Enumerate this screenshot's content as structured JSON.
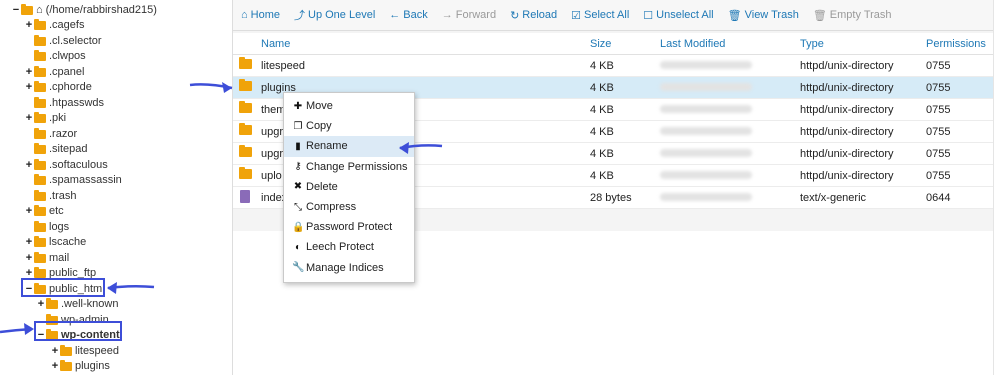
{
  "tree": {
    "root": "(/home/rabbirshad215)",
    "nodes": [
      {
        "toggle": "+",
        "label": ".cagefs",
        "indent": 1
      },
      {
        "toggle": "",
        "label": ".cl.selector",
        "indent": 1
      },
      {
        "toggle": "",
        "label": ".clwpos",
        "indent": 1
      },
      {
        "toggle": "+",
        "label": ".cpanel",
        "indent": 1
      },
      {
        "toggle": "+",
        "label": ".cphorde",
        "indent": 1
      },
      {
        "toggle": "",
        "label": ".htpasswds",
        "indent": 1
      },
      {
        "toggle": "+",
        "label": ".pki",
        "indent": 1
      },
      {
        "toggle": "",
        "label": ".razor",
        "indent": 1
      },
      {
        "toggle": "",
        "label": ".sitepad",
        "indent": 1
      },
      {
        "toggle": "+",
        "label": ".softaculous",
        "indent": 1
      },
      {
        "toggle": "",
        "label": ".spamassassin",
        "indent": 1
      },
      {
        "toggle": "",
        "label": ".trash",
        "indent": 1
      },
      {
        "toggle": "+",
        "label": "etc",
        "indent": 1
      },
      {
        "toggle": "",
        "label": "logs",
        "indent": 1
      },
      {
        "toggle": "+",
        "label": "lscache",
        "indent": 1
      },
      {
        "toggle": "+",
        "label": "mail",
        "indent": 1
      },
      {
        "toggle": "+",
        "label": "public_ftp",
        "indent": 1
      },
      {
        "toggle": "−",
        "label": "public_html",
        "indent": 1
      },
      {
        "toggle": "+",
        "label": ".well-known",
        "indent": 2
      },
      {
        "toggle": "",
        "label": "wp-admin",
        "indent": 2
      },
      {
        "toggle": "−",
        "label": "wp-content",
        "indent": 2
      },
      {
        "toggle": "+",
        "label": "litespeed",
        "indent": 3
      },
      {
        "toggle": "+",
        "label": "plugins",
        "indent": 3
      }
    ]
  },
  "toolbar": {
    "home": "Home",
    "up": "Up One Level",
    "back": "Back",
    "forward": "Forward",
    "reload": "Reload",
    "select_all": "Select All",
    "unselect_all": "Unselect All",
    "view_trash": "View Trash",
    "empty_trash": "Empty Trash"
  },
  "table": {
    "headers": {
      "name": "Name",
      "size": "Size",
      "modified": "Last Modified",
      "type": "Type",
      "perm": "Permissions"
    },
    "rows": [
      {
        "name": "litespeed",
        "size": "4 KB",
        "type": "httpd/unix-directory",
        "perm": "0755",
        "icon": "folder"
      },
      {
        "name": "plugins",
        "size": "4 KB",
        "type": "httpd/unix-directory",
        "perm": "0755",
        "icon": "folder"
      },
      {
        "name": "them",
        "size": "4 KB",
        "type": "httpd/unix-directory",
        "perm": "0755",
        "icon": "folder"
      },
      {
        "name": "upgr",
        "size": "4 KB",
        "type": "httpd/unix-directory",
        "perm": "0755",
        "icon": "folder"
      },
      {
        "name": "upgr",
        "size": "4 KB",
        "type": "httpd/unix-directory",
        "perm": "0755",
        "icon": "folder"
      },
      {
        "name": "uplo",
        "size": "4 KB",
        "type": "httpd/unix-directory",
        "perm": "0755",
        "icon": "folder"
      },
      {
        "name": "index",
        "size": "28 bytes",
        "type": "text/x-generic",
        "perm": "0644",
        "icon": "file"
      }
    ]
  },
  "context_menu": {
    "items": [
      {
        "label": "Move",
        "icon": "move-icon",
        "glyph": "✚"
      },
      {
        "label": "Copy",
        "icon": "copy-icon",
        "glyph": "❐"
      },
      {
        "label": "Rename",
        "icon": "file-icon",
        "glyph": "▮"
      },
      {
        "label": "Change Permissions",
        "icon": "key-icon",
        "glyph": "⚷"
      },
      {
        "label": "Delete",
        "icon": "close-icon",
        "glyph": "✖"
      },
      {
        "label": "Compress",
        "icon": "compress-icon",
        "glyph": "⤡"
      },
      {
        "label": "Password Protect",
        "icon": "lock-icon",
        "glyph": "🔒"
      },
      {
        "label": "Leech Protect",
        "icon": "shield-icon",
        "glyph": "◐"
      },
      {
        "label": "Manage Indices",
        "icon": "wrench-icon",
        "glyph": "🔧"
      }
    ]
  },
  "colors": {
    "accent": "#1e78b5",
    "annotation": "#3d4ed8",
    "folder": "#f0a30a",
    "selected_row": "#d6ebf7"
  }
}
